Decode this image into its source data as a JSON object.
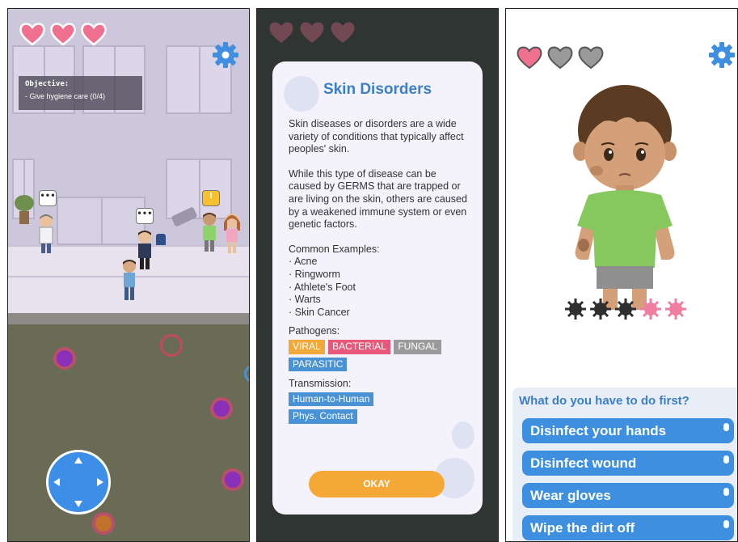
{
  "panel_left": {
    "hearts_filled": 3,
    "objective": {
      "title": "Objective:",
      "task": "- Give hygiene care (0/4)"
    },
    "speech_bubbles": [
      "•••",
      "•••",
      "!"
    ]
  },
  "panel_center": {
    "dialog": {
      "title": "Skin Disorders",
      "paragraph1": "Skin diseases or disorders are a wide variety of conditions that typically affect peoples' skin.",
      "paragraph2": "While this type of disease can be caused by GERMS that are trapped or are living on the skin, others are caused by a weakened immune system or even genetic factors.",
      "examples_heading": "Common Examples:",
      "examples": [
        "· Acne",
        "· Ringworm",
        "· Athlete's Foot",
        "· Warts",
        "· Skin Cancer"
      ],
      "pathogens_heading": "Pathogens:",
      "pathogens": [
        {
          "label": "VIRAL",
          "color": "#f2a93b"
        },
        {
          "label": "BACTERIAL",
          "color": "#e8587a"
        },
        {
          "label": "FUNGAL",
          "color": "#9a9a9a"
        },
        {
          "label": "PARASITIC",
          "color": "#4a92d6"
        }
      ],
      "transmission_heading": "Transmission:",
      "transmission": [
        "Human-to-Human",
        "Phys. Contact"
      ],
      "okay_label": "OKAY"
    }
  },
  "panel_right": {
    "hearts_filled": 1,
    "hearts_total": 3,
    "germs_dark": 3,
    "germs_pink": 2,
    "question": "What do you have to do first?",
    "answers": [
      "Disinfect your hands",
      "Disinfect wound",
      "Wear gloves",
      "Wipe the dirt off"
    ]
  },
  "colors": {
    "accent_blue": "#3e8fe0",
    "heart_pink": "#f0708f",
    "okay_orange": "#f5a836"
  }
}
